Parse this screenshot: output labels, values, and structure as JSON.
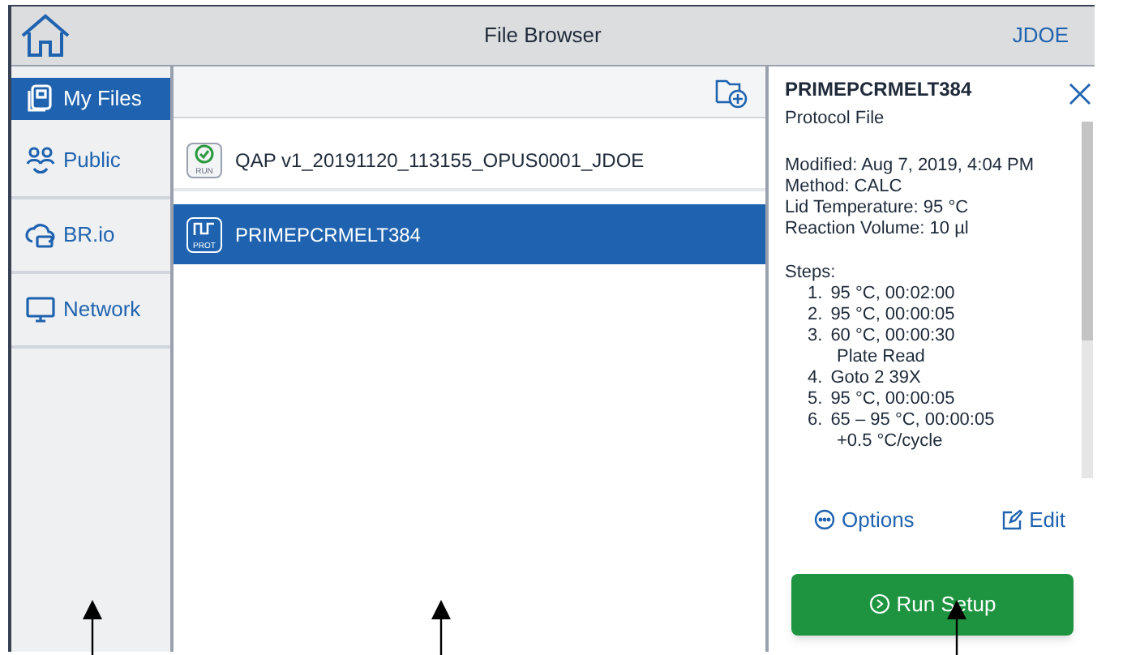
{
  "header": {
    "title": "File Browser",
    "user": "JDOE"
  },
  "sidebar": {
    "items": [
      {
        "label": "My Files",
        "kind": "files",
        "selected": true
      },
      {
        "label": "Public",
        "kind": "people",
        "selected": false
      },
      {
        "label": "BR.io",
        "kind": "cloud",
        "selected": false
      },
      {
        "label": "Network",
        "kind": "monitor",
        "selected": false
      }
    ]
  },
  "files": [
    {
      "name": "QAP v1_20191120_113155_OPUS0001_JDOE",
      "kind": "run",
      "badge": "RUN",
      "selected": false
    },
    {
      "name": "PRIMEPCRMELT384",
      "kind": "protocol",
      "badge": "PROT",
      "selected": true
    }
  ],
  "details": {
    "title": "PRIMEPCRMELT384",
    "type": "Protocol File",
    "info": [
      "Modified: Aug 7, 2019, 4:04 PM",
      "Method: CALC",
      "Lid Temperature: 95 °C",
      "Reaction Volume: 10 µl"
    ],
    "steps_label": "Steps:",
    "steps": [
      {
        "number": "1.",
        "text": "95 °C, 00:02:00"
      },
      {
        "number": "2.",
        "text": "95 °C, 00:00:05"
      },
      {
        "number": "3.",
        "text": "60 °C, 00:00:30",
        "note": "Plate Read"
      },
      {
        "number": "4.",
        "text": "Goto 2 39X"
      },
      {
        "number": "5.",
        "text": "95 °C, 00:00:05"
      },
      {
        "number": "6.",
        "text": "65 – 95 °C, 00:00:05",
        "note": "+0.5 °C/cycle"
      }
    ],
    "options": "Options",
    "edit": "Edit",
    "run": "Run Setup"
  }
}
